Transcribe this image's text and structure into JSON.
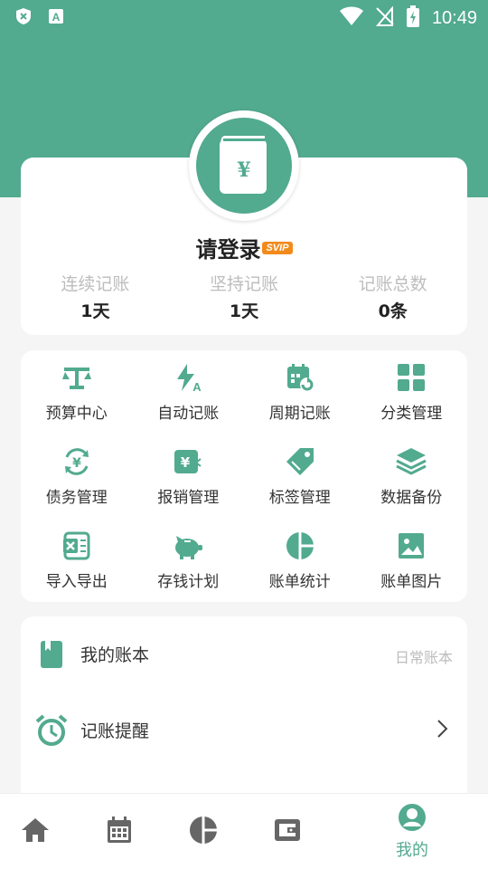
{
  "status_bar": {
    "time": "10:49"
  },
  "profile": {
    "login_label": "请登录",
    "badge": "SVIP",
    "stats": [
      {
        "label": "连续记账",
        "value": "1天"
      },
      {
        "label": "坚持记账",
        "value": "1天"
      },
      {
        "label": "记账总数",
        "value": "0条"
      }
    ]
  },
  "features": [
    {
      "label": "预算中心",
      "icon": "scale-icon"
    },
    {
      "label": "自动记账",
      "icon": "auto-bolt-icon"
    },
    {
      "label": "周期记账",
      "icon": "calendar-refresh-icon"
    },
    {
      "label": "分类管理",
      "icon": "grid-icon"
    },
    {
      "label": "债务管理",
      "icon": "yen-cycle-icon"
    },
    {
      "label": "报销管理",
      "icon": "reimburse-icon"
    },
    {
      "label": "标签管理",
      "icon": "tag-icon"
    },
    {
      "label": "数据备份",
      "icon": "layers-icon"
    },
    {
      "label": "导入导出",
      "icon": "excel-icon"
    },
    {
      "label": "存钱计划",
      "icon": "piggy-bank-icon"
    },
    {
      "label": "账单统计",
      "icon": "pie-chart-icon"
    },
    {
      "label": "账单图片",
      "icon": "image-icon"
    }
  ],
  "list": {
    "my_book": {
      "label": "我的账本",
      "value": "日常账本"
    },
    "reminder": {
      "label": "记账提醒"
    }
  },
  "bottom_nav": {
    "items": [
      "home-icon",
      "calendar-icon",
      "pie-chart-icon",
      "wallet-icon",
      "profile-icon"
    ],
    "active_label": "我的"
  },
  "colors": {
    "accent": "#52aa8f",
    "badge": "#f28a1b"
  }
}
